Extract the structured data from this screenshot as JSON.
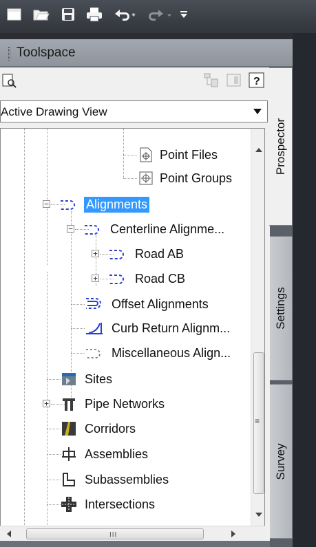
{
  "qat": {
    "icons": [
      "new-icon",
      "open-icon",
      "save-icon",
      "print-icon",
      "undo-icon",
      "redo-icon",
      "customize-dropdown-icon"
    ]
  },
  "palette": {
    "title": "Toolspace",
    "view_selector": "Active Drawing View",
    "tabs": [
      "Prospector",
      "Settings",
      "Survey"
    ]
  },
  "tree": {
    "point_files": "Point Files",
    "point_groups": "Point Groups",
    "alignments": "Alignments",
    "centerline": "Centerline Alignme...",
    "road_ab": "Road AB",
    "road_cb": "Road CB",
    "offset": "Offset Alignments",
    "curb_return": "Curb Return Alignm...",
    "misc": "Miscellaneous Align...",
    "sites": "Sites",
    "pipe_networks": "Pipe Networks",
    "corridors": "Corridors",
    "assemblies": "Assemblies",
    "subassemblies": "Subassemblies",
    "intersections": "Intersections"
  },
  "scroll": {
    "thumb_glyph": "≡",
    "h_thumb_glyph": "III"
  },
  "colors": {
    "selection": "#3399ff",
    "alignment_icon": "#2b3fd0"
  }
}
